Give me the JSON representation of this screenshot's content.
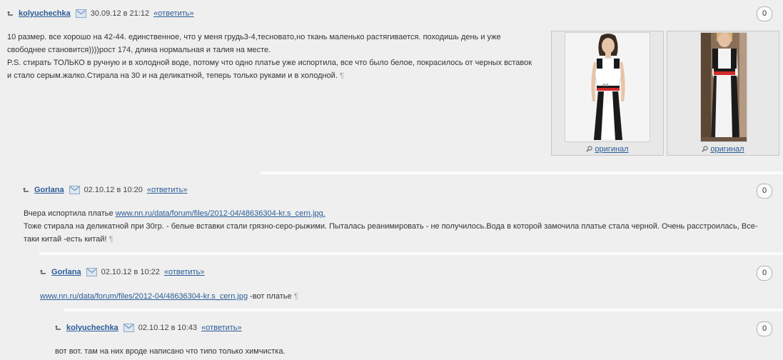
{
  "comments": [
    {
      "author": "kolyuchechka",
      "date": "30.09.12 в 21:12",
      "reply": "«ответить»",
      "count": "0",
      "lines": [
        "10 размер. все хорошо на 42-44. единственное, что у меня грудь3-4,тесновато,но ткань маленько растягивается. походишь день и уже",
        "свободнее становится))))рост 174, длина нормальная и талия на месте.",
        "P.S. стирать ТОЛЬКО в ручную и в холодной воде, потому что одно платье уже испортила, все что было белое, покрасилось от черных вставок",
        "и стало серым.жалко.Стирала на 30 и на деликатной, теперь только руками и в холодной."
      ],
      "images": [
        {
          "caption": "оригинал"
        },
        {
          "caption": "оригинал"
        }
      ]
    },
    {
      "author": "Gorlana",
      "date": "02.10.12 в 10:20",
      "reply": "«ответить»",
      "count": "0",
      "line1_prefix": "Вчера испортила платье ",
      "line1_link": "www.nn.ru/data/forum/files/2012-04/48636304-kr.s_cern.jpg.",
      "line2": "Тоже стирала на деликатной при 30гр. - белые вставки стали грязно-серо-рыжими. Пыталась реанимировать - не получилось.Вода в которой замочила платье стала черной. Очень расстроилась, Все-",
      "line3": "таки китай -есть китай!"
    },
    {
      "author": "Gorlana",
      "date": "02.10.12 в 10:22",
      "reply": "«ответить»",
      "count": "0",
      "link": "www.nn.ru/data/forum/files/2012-04/48636304-kr.s_cern.jpg",
      "suffix": " -вот платье"
    },
    {
      "author": "kolyuchechka",
      "date": "02.10.12 в 10:43",
      "reply": "«ответить»",
      "count": "0",
      "line1": "вот вот. там на них вроде написано что типо только химчистка."
    }
  ],
  "pilcrow": "¶",
  "colors": {
    "link": "#2a5c98",
    "background": "#efefef",
    "dress_red": "#d42a2a"
  }
}
